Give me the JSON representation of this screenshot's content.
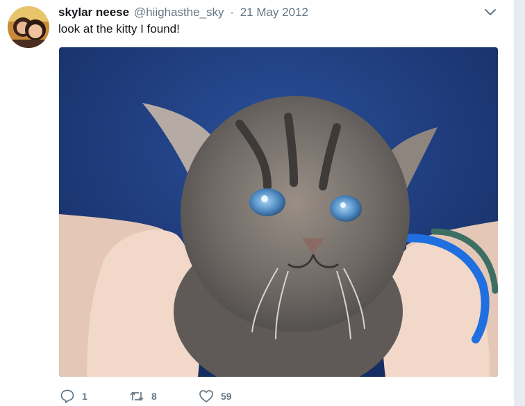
{
  "tweet": {
    "display_name": "skylar neese",
    "handle": "@hiighasthe_sky",
    "separator": "·",
    "date": "21 May 2012",
    "text": "look at the kitty I found!",
    "icons": {
      "more": "chevron-down-icon",
      "reply": "reply-icon",
      "retweet": "retweet-icon",
      "like": "heart-icon"
    },
    "media_description": "kitten-photo",
    "actions": {
      "reply_count": "1",
      "retweet_count": "8",
      "like_count": "59"
    }
  },
  "colors": {
    "text": "#14171a",
    "muted": "#657786",
    "gutter": "#e6ecf0"
  }
}
